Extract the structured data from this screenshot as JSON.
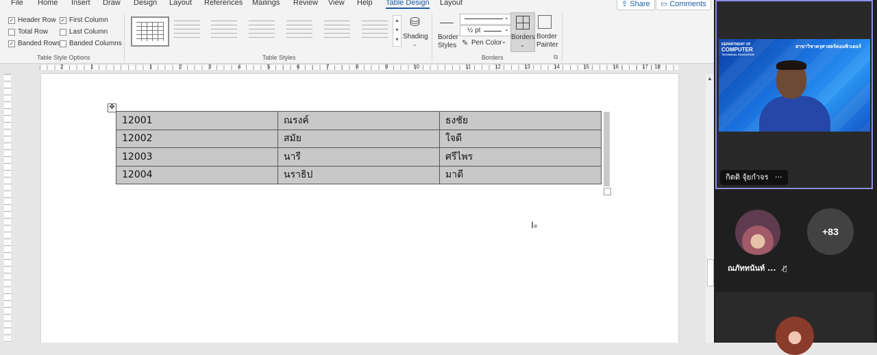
{
  "ribbon": {
    "tabs": [
      "File",
      "Home",
      "Insert",
      "Draw",
      "Design",
      "Layout",
      "References",
      "Mailings",
      "Review",
      "View",
      "Help",
      "Table Design",
      "Layout"
    ],
    "active_tab": "Table Design",
    "share_label": "Share",
    "comments_label": "Comments",
    "style_options": {
      "label": "Table Style Options",
      "items": [
        {
          "label": "Header Row",
          "checked": true
        },
        {
          "label": "First Column",
          "checked": true
        },
        {
          "label": "Total Row",
          "checked": false
        },
        {
          "label": "Last Column",
          "checked": false
        },
        {
          "label": "Banded Rows",
          "checked": true
        },
        {
          "label": "Banded Columns",
          "checked": false
        }
      ]
    },
    "table_styles": {
      "label": "Table Styles",
      "shading_label": "Shading"
    },
    "borders": {
      "label": "Borders",
      "border_styles_label": "Border Styles",
      "weight_label": "½ pt",
      "pen_color_label": "Pen Color",
      "borders_button_label": "Borders",
      "border_painter_label": "Border Painter"
    }
  },
  "ruler": {
    "h_numbers": [
      "2",
      "1",
      "1",
      "2",
      "3",
      "4",
      "5",
      "6",
      "7",
      "8",
      "9",
      "10",
      "11",
      "12",
      "13",
      "14",
      "15",
      "16",
      "17",
      "18"
    ]
  },
  "document": {
    "table": [
      [
        "12001",
        "ณรงค์",
        "ธงชัย"
      ],
      [
        "12002",
        "สมัย",
        "ใจดี"
      ],
      [
        "12003",
        "นารี",
        "ศรีไพร"
      ],
      [
        "12004",
        "นราธิป",
        "มาดี"
      ]
    ]
  },
  "meeting": {
    "speaker": {
      "name": "กิตติ จุ้ยกำจร",
      "more_label": "···",
      "logo_line1": "DEPARTMENT OF",
      "logo_line2": "COMPUTER",
      "logo_line3": "TECHNICAL EDUCATION",
      "banner": "สาขาวิชาครุศาสตร์คอมพิวเตอร์"
    },
    "participant2_name": "ณภัททนันท์ ...",
    "more_count": "+83"
  },
  "colors": {
    "accent": "#1b5ba8",
    "table_fill": "#c8c8c8",
    "speaker_border": "#8e8ff0"
  }
}
